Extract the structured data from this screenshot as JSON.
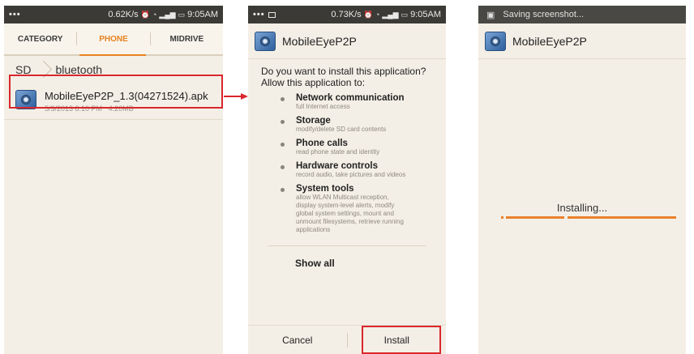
{
  "phone1": {
    "status": {
      "dots": "•••",
      "speed": "0.62K/s",
      "time": "9:05AM"
    },
    "tabs": [
      "CATEGORY",
      "PHONE",
      "MIDRIVE"
    ],
    "breadcrumbs": [
      "SD",
      "bluetooth"
    ],
    "file": {
      "name": "MobileEyeP2P_1.3(04271524).apk",
      "date": "5/3/2013 8:10 PM",
      "size": "4.20MB"
    }
  },
  "phone2": {
    "status": {
      "dots": "•••",
      "speed": "0.73K/s",
      "time": "9:05AM"
    },
    "app_name": "MobileEyeP2P",
    "question": "Do you want to install this application?",
    "allow": "Allow this application to:",
    "permissions": [
      {
        "title": "Network communication",
        "desc": "full Internet access"
      },
      {
        "title": "Storage",
        "desc": "modify/delete SD card contents"
      },
      {
        "title": "Phone calls",
        "desc": "read phone state and identity"
      },
      {
        "title": "Hardware controls",
        "desc": "record audio, take pictures and videos"
      },
      {
        "title": "System tools",
        "desc": "allow WLAN Multicast reception, display system-level alerts, modify global system settings, mount and unmount filesystems, retrieve running applications"
      }
    ],
    "show_all": "Show all",
    "cancel": "Cancel",
    "install": "Install"
  },
  "phone3": {
    "saving": "Saving screenshot...",
    "app_name": "MobileEyeP2P",
    "installing": "Installing..."
  },
  "colors": {
    "accent": "#e8821e",
    "highlight": "#d9272e",
    "background": "#f4efe6"
  }
}
